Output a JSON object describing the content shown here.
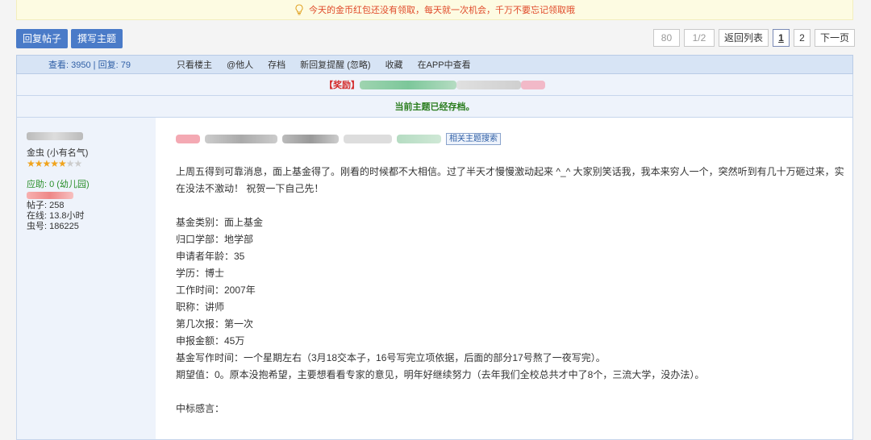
{
  "notice": {
    "text": "今天的金币红包还没有领取，每天就一次机会，千万不要忘记领取哦"
  },
  "toolbar": {
    "reply_label": "回复帖子",
    "new_topic_label": "撰写主题",
    "pager": {
      "count": "80",
      "pages": "1/2",
      "back": "返回列表",
      "current": "1",
      "page2": "2",
      "next": "下一页"
    }
  },
  "thread_bar": {
    "stats": "查看: 3950  |  回复: 79",
    "links": [
      "只看楼主",
      "@他人",
      "存档",
      "新回复提醒 (忽略)",
      "收藏",
      "在APP中查看"
    ]
  },
  "reward": {
    "tag": "【奖励】"
  },
  "archived_text": "当前主题已经存档。",
  "author": {
    "level": "金虫 (小有名气)",
    "stars_filled": 5,
    "stars_total": 7,
    "help": "应助: 0 (幼儿园)",
    "posts": "帖子: 258",
    "online": "在线: 13.8小时",
    "uid": "虫号: 186225"
  },
  "post": {
    "search_tag": "相关主题搜索",
    "intro": "上周五得到可靠消息，面上基金得了。刚看的时候都不大相信。过了半天才慢慢激动起来 ^_^ 大家别笑话我，我本来穷人一个，突然听到有几十万砸过来，实在没法不激动！ 祝贺一下自己先！",
    "fields": [
      "基金类别：面上基金",
      "归口学部：地学部",
      "申请者年龄：35",
      "学历：博士",
      "工作时间：2007年",
      "职称：讲师",
      "第几次报：第一次",
      "申报金额：45万",
      "基金写作时间：一个星期左右（3月18交本子，16号写完立项依据，后面的部分17号熬了一夜写完）。",
      "期望值：0。原本没抱希望，主要想看看专家的意见，明年好继续努力（去年我们全校总共才中了8个，三流大学，没办法）。"
    ],
    "section_title": "中标感言："
  }
}
